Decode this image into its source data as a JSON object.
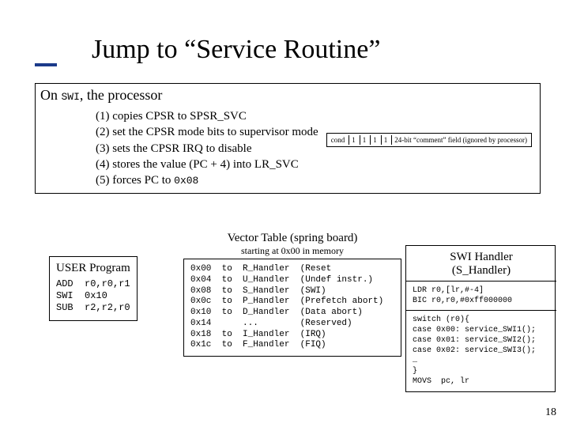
{
  "title": "Jump to “Service Routine”",
  "intro_pre": "On ",
  "intro_swi": "SWI",
  "intro_post": ", the processor",
  "steps": {
    "s1_a": "(1) copies CPSR to SPSR_SVC",
    "s2_a": "(2) set the CPSR mode bits to supervisor mode",
    "s3_a": "(3) sets the CPSR  IRQ to disable",
    "s4_a": "(4) stores the value (PC  +  4) into LR_SVC",
    "s5_a": "(5) forces PC to ",
    "s5_b": "0x08"
  },
  "swi_encoding": {
    "f1": "cond",
    "f2": "1",
    "f3": "1",
    "f4": "1",
    "f5": "1",
    "f6": "24-bit “comment” field (ignored by processor)"
  },
  "user": {
    "label": "USER Program",
    "code": "ADD  r0,r0,r1\nSWI  0x10\nSUB  r2,r2,r0"
  },
  "vector": {
    "head1": "Vector Table (spring board)",
    "head2": "starting at 0x00 in memory",
    "code": "0x00  to  R_Handler  (Reset\n0x04  to  U_Handler  (Undef instr.)\n0x08  to  S_Handler  (SWI)\n0x0c  to  P_Handler  (Prefetch abort)\n0x10  to  D_Handler  (Data abort)\n0x14      ...        (Reserved)\n0x18  to  I_Handler  (IRQ)\n0x1c  to  F_Handler  (FIQ)"
  },
  "handler": {
    "title1": "SWI Handler",
    "title2": "(S_Handler)",
    "setup": "LDR r0,[lr,#-4]\nBIC r0,r0,#0xff000000",
    "body": "switch (r0){\ncase 0x00: service_SWI1();\ncase 0x01: service_SWI2();\ncase 0x02: service_SWI3();\n…\n}\nMOVS  pc, lr"
  },
  "pagenum": "18"
}
